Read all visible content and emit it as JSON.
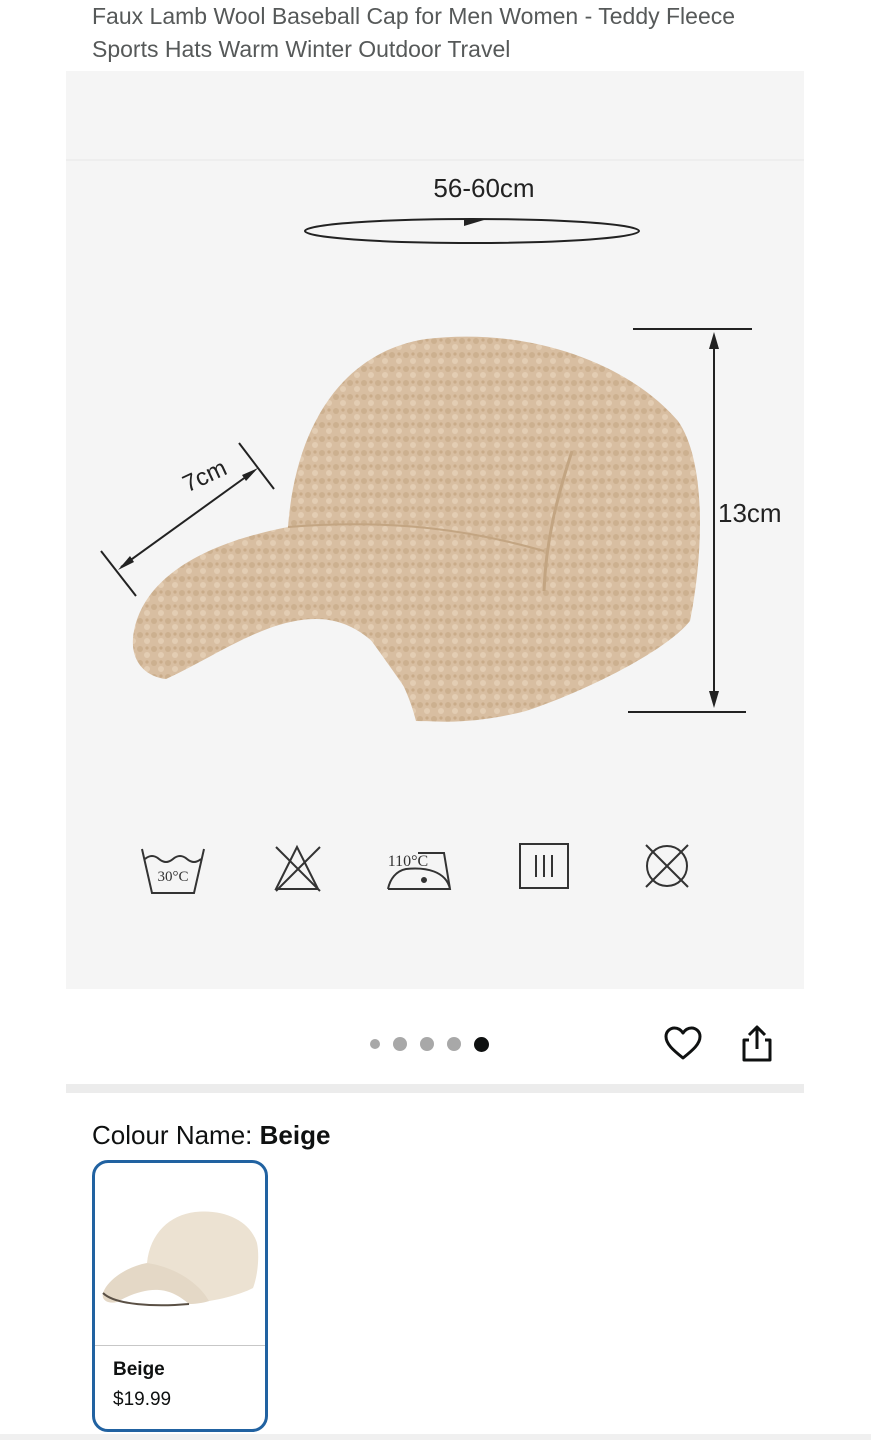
{
  "product": {
    "title": "Faux Lamb Wool Baseball Cap for Men Women - Teddy Fleece Sports Hats Warm Winter Outdoor Travel"
  },
  "image": {
    "dimension_circumference": "56-60cm",
    "dimension_brim": "7cm",
    "dimension_height": "13cm",
    "care_temp_wash": "30°C",
    "care_temp_iron": "110°C",
    "care_icons": [
      "wash-30-icon",
      "no-bleach-icon",
      "iron-110-icon",
      "tumble-dry-icon",
      "no-dry-clean-icon"
    ]
  },
  "gallery": {
    "dot_count": 5,
    "active_index": 4
  },
  "actions": {
    "wishlist_icon": "heart-icon",
    "share_icon": "share-icon"
  },
  "variation": {
    "label": "Colour Name: ",
    "selected": "Beige",
    "options": [
      {
        "name": "Beige",
        "price": "$19.99"
      }
    ]
  },
  "colors": {
    "accent": "#2162a1",
    "cap": "#d9c0a4"
  }
}
